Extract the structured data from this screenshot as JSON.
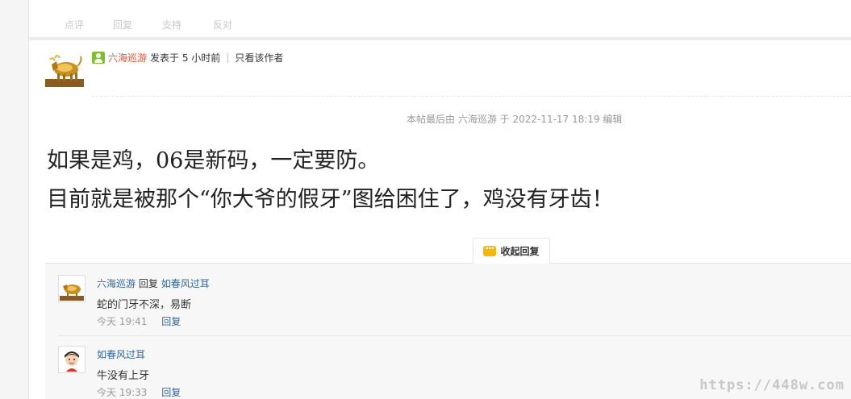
{
  "actions": {
    "comment": "点评",
    "reply": "回复",
    "support": "支持",
    "oppose": "反对"
  },
  "post": {
    "author": "六海巡游",
    "posted_at": "发表于 5 小时前",
    "only_author": "只看该作者",
    "edit_note": "本帖最后由 六海巡游 于 2022-11-17 18:19 编辑",
    "body_line1": "如果是鸡，06是新码，一定要防。",
    "body_line2": "目前就是被那个“你大爷的假牙”图给困住了，鸡没有牙齿！"
  },
  "collapse_label": "收起回复",
  "replies": [
    {
      "author": "六海巡游",
      "action": "回复",
      "target": "如春风过耳",
      "text": "蛇的门牙不深，易断",
      "time": "今天 19:41",
      "reply_label": "回复"
    },
    {
      "author": "如春风过耳",
      "text": "牛没有上牙",
      "time": "今天 19:33",
      "reply_label": "回复"
    }
  ],
  "watermark": "https://448w.com",
  "colors": {
    "author_red": "#e2553c",
    "link_blue": "#336699",
    "online_green": "#7fbf2f",
    "comment_icon_yellow": "#f5b800"
  }
}
